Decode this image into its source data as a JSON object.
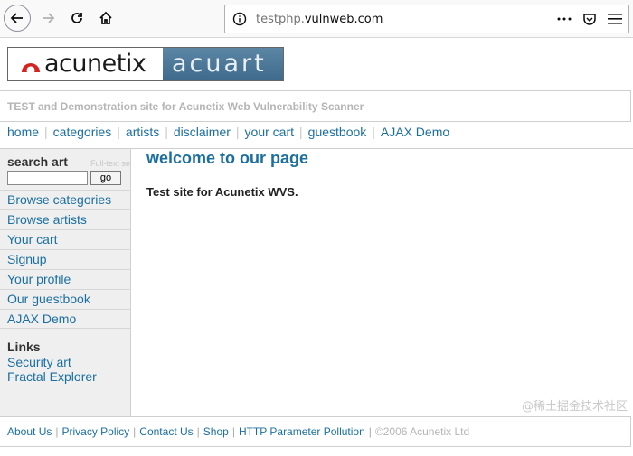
{
  "browser": {
    "url_prefix": "testphp.",
    "url_host": "vulnweb.com",
    "more_icon": "more-icon",
    "pocket_icon": "pocket-icon",
    "menu_icon": "hamburger-icon"
  },
  "logo": {
    "brand": "acunetix",
    "product": "acuart"
  },
  "tagline": "TEST and Demonstration site for Acunetix Web Vulnerability Scanner",
  "topnav": [
    "home",
    "categories",
    "artists",
    "disclaimer",
    "your cart",
    "guestbook",
    "AJAX Demo"
  ],
  "sidebar": {
    "search_label": "search art",
    "ghost_text": "Full-text search",
    "go_label": "go",
    "items": [
      "Browse categories",
      "Browse artists",
      "Your cart",
      "Signup",
      "Your profile",
      "Our guestbook",
      "AJAX Demo"
    ],
    "links_title": "Links",
    "links": [
      "Security art",
      "Fractal Explorer"
    ]
  },
  "main": {
    "title": "welcome to our page",
    "text": "Test site for Acunetix WVS."
  },
  "footer": {
    "links": [
      "About Us",
      "Privacy Policy",
      "Contact Us",
      "Shop",
      "HTTP Parameter Pollution"
    ],
    "copyright": "©2006 Acunetix Ltd"
  },
  "watermark": "@稀土掘金技术社区",
  "colors": {
    "link": "#1b6fa0",
    "tagline": "#b5b5b5",
    "logo_panel": "#4f7a9a"
  }
}
